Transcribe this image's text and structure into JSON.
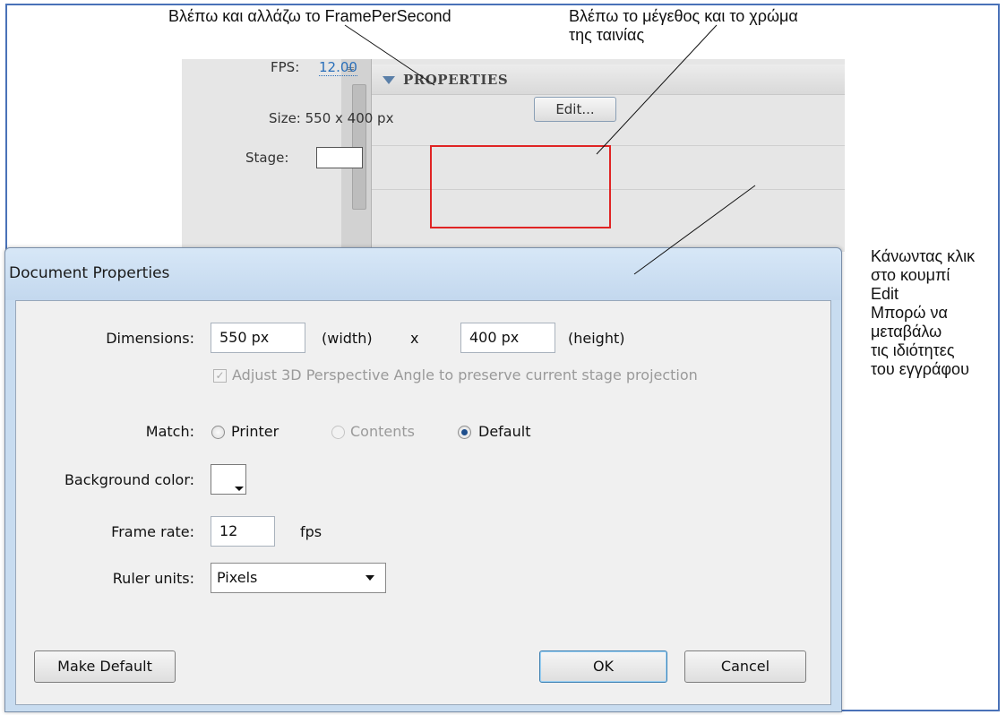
{
  "annotations": {
    "fps_note": "Βλέπω και αλλάζω το FramePerSecond",
    "size_note": "Βλέπω το μέγεθος και το χρώμα\nτης ταινίας",
    "edit_note": "Κάνωντας κλικ\nστο κουμπί\nEdit\nΜπορώ να\nμεταβάλω\nτις ιδιότητες\nτου εγγράφου"
  },
  "properties_panel": {
    "title": "PROPERTIES",
    "fps_label": "FPS:",
    "fps_value": "12.00",
    "size_label": "Size:  550 x 400 px",
    "edit_button": "Edit...",
    "stage_label": "Stage:",
    "stage_color": "#ffffff"
  },
  "dialog": {
    "title": "Document Properties",
    "dimensions_label": "Dimensions:",
    "width_value": "550 px",
    "width_suffix": "(width)",
    "times": "x",
    "height_value": "400 px",
    "height_suffix": "(height)",
    "adjust_3d_label": "Adjust 3D Perspective Angle to preserve current stage projection",
    "adjust_3d_checked": true,
    "match_label": "Match:",
    "match_options": [
      "Printer",
      "Contents",
      "Default"
    ],
    "match_selected": "Default",
    "background_label": "Background color:",
    "background_color": "#ffffff",
    "frame_rate_label": "Frame rate:",
    "frame_rate_value": "12",
    "frame_rate_unit": "fps",
    "ruler_label": "Ruler units:",
    "ruler_value": "Pixels",
    "make_default_button": "Make Default",
    "ok_button": "OK",
    "cancel_button": "Cancel"
  }
}
